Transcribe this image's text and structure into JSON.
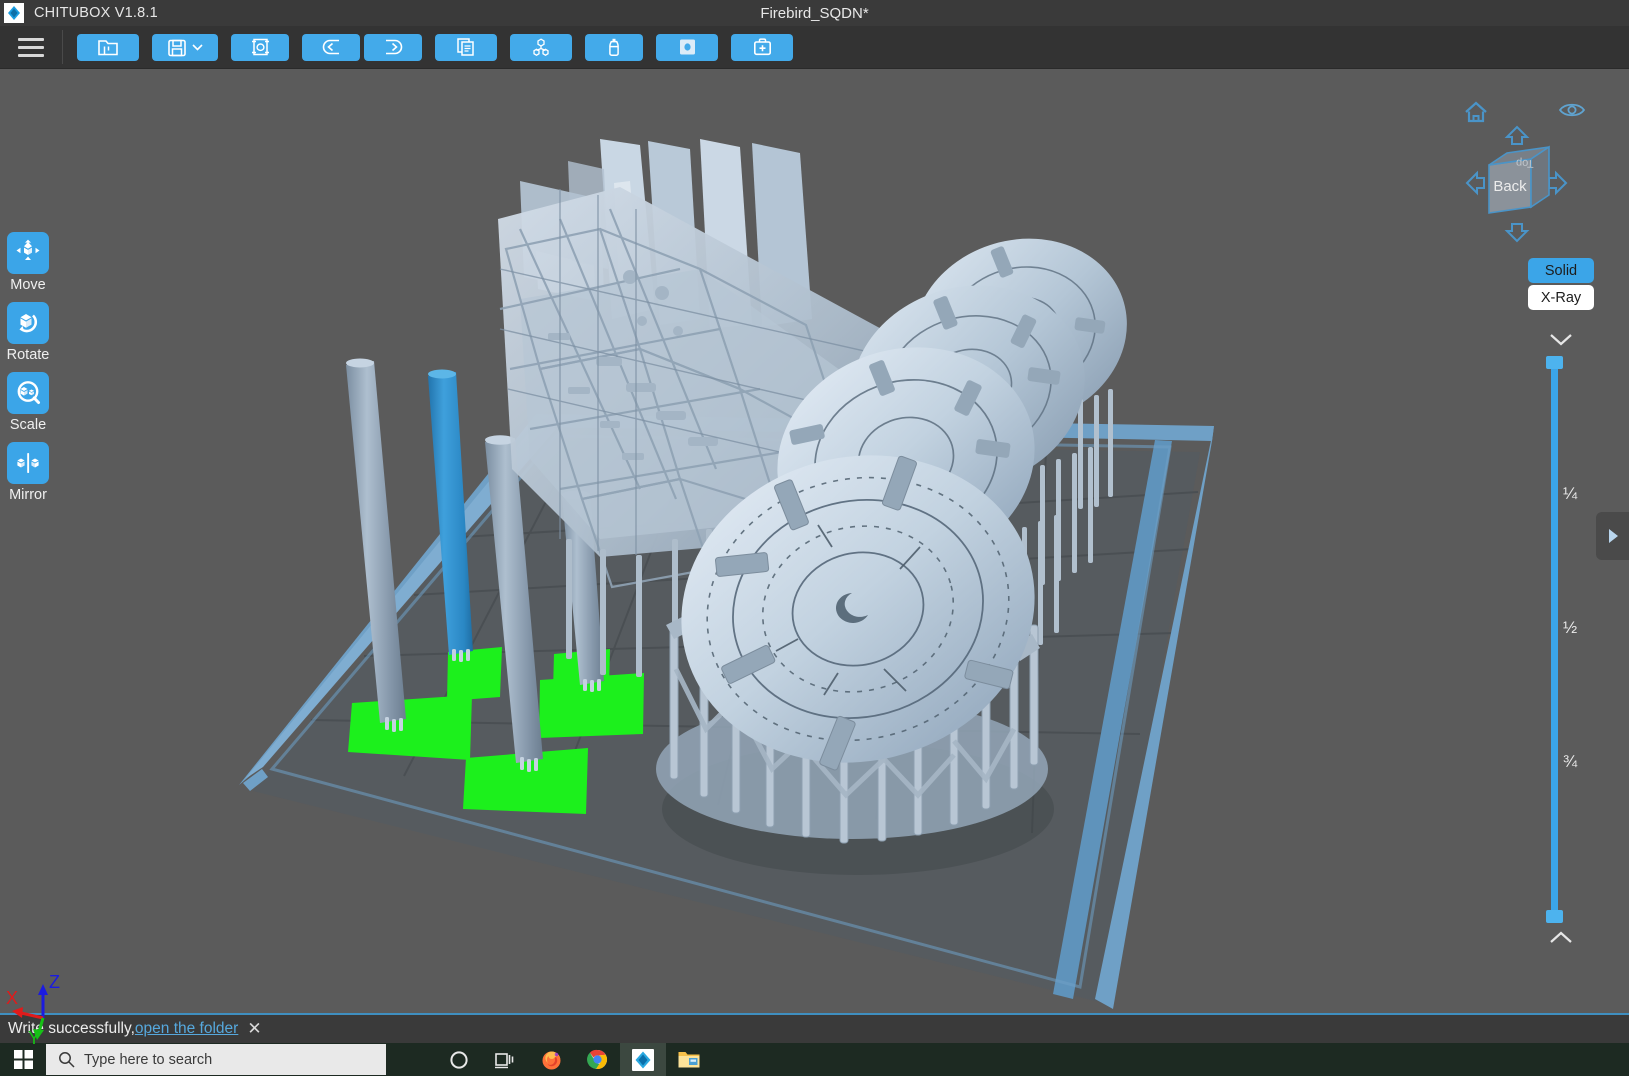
{
  "window": {
    "app_title": "CHITUBOX V1.8.1",
    "document_title": "Firebird_SQDN*",
    "logo_icon": "chitubox-diamond-logo"
  },
  "toolbar": {
    "menu_icon": "hamburger-menu-icon",
    "buttons": [
      {
        "name": "open-file-button",
        "icon": "folder-open-icon",
        "tooltip": "Open"
      },
      {
        "name": "save-file-button",
        "icon": "floppy-save-icon",
        "tooltip": "Save",
        "has_dropdown": true
      },
      {
        "name": "place-on-plate-button",
        "icon": "model-on-plate-icon",
        "tooltip": "Place"
      },
      {
        "name": "undo-button",
        "icon": "arrow-left-icon",
        "tooltip": "Undo"
      },
      {
        "name": "redo-button",
        "icon": "arrow-right-icon",
        "tooltip": "Redo"
      },
      {
        "name": "copy-button",
        "icon": "copy-pages-icon",
        "tooltip": "Copy"
      },
      {
        "name": "support-button",
        "icon": "supports-tree-icon",
        "tooltip": "Supports"
      },
      {
        "name": "hollow-button",
        "icon": "bottle-hollow-icon",
        "tooltip": "Hollow"
      },
      {
        "name": "dig-hole-button",
        "icon": "hole-punch-icon",
        "tooltip": "Dig Hole"
      },
      {
        "name": "repair-button",
        "icon": "first-aid-repair-icon",
        "tooltip": "Repair"
      }
    ]
  },
  "left_rail": [
    {
      "name": "move-tool",
      "icon": "move-arrows-cube-icon",
      "label": "Move"
    },
    {
      "name": "rotate-tool",
      "icon": "rotate-cube-icon",
      "label": "Rotate"
    },
    {
      "name": "scale-tool",
      "icon": "scale-magnifier-icon",
      "label": "Scale"
    },
    {
      "name": "mirror-tool",
      "icon": "mirror-cubes-icon",
      "label": "Mirror"
    }
  ],
  "view_controls": {
    "home_icon": "home-icon",
    "eye_icon": "eye-visibility-icon",
    "nav_cube": {
      "front_face_label": "Back",
      "top_face_label": "Top",
      "arrow_up": "nav-arrow-up",
      "arrow_down": "nav-arrow-down",
      "arrow_left": "nav-arrow-left",
      "arrow_right": "nav-arrow-right"
    },
    "render_modes": [
      {
        "name": "solid-mode-button",
        "label": "Solid",
        "selected": true
      },
      {
        "name": "xray-mode-button",
        "label": "X-Ray",
        "selected": false
      }
    ],
    "chevron_down_icon": "chevron-down-icon",
    "chevron_up_icon": "chevron-up-icon",
    "slider": {
      "name": "layer-preview-slider",
      "ticks": [
        "¼",
        "½",
        "¾"
      ]
    },
    "panel_expand_icon": "triangle-right-expand-icon"
  },
  "axis_gizmo": {
    "x_label": "X",
    "x_color": "#e01b1b",
    "y_label": "Y",
    "y_color": "#16c216",
    "z_label": "Z",
    "z_color": "#1b1be0"
  },
  "status_bar": {
    "message": "Write successfully,",
    "link_text": "open the folder",
    "close_icon": "close-x-icon"
  },
  "taskbar": {
    "start_icon": "windows-start-icon",
    "search_icon": "search-magnifier-icon",
    "search_placeholder": "Type here to search",
    "items": [
      {
        "name": "taskview-cortana-icon",
        "icon": "cortana-circle-icon"
      },
      {
        "name": "taskview-button",
        "icon": "task-view-icon"
      },
      {
        "name": "firefox-taskbar-icon",
        "icon": "firefox-icon"
      },
      {
        "name": "chrome-taskbar-icon",
        "icon": "chrome-icon"
      },
      {
        "name": "chitubox-taskbar-icon",
        "icon": "chitubox-diamond-logo",
        "active": true
      },
      {
        "name": "explorer-taskbar-icon",
        "icon": "file-explorer-folder-icon"
      }
    ]
  },
  "scene": {
    "background_color": "#5b5b5b",
    "plate_color": "#6d95b2",
    "model_color": "#b6c6d6",
    "selected_color": "#2f8fd0",
    "raft_color": "#1cf01c"
  }
}
